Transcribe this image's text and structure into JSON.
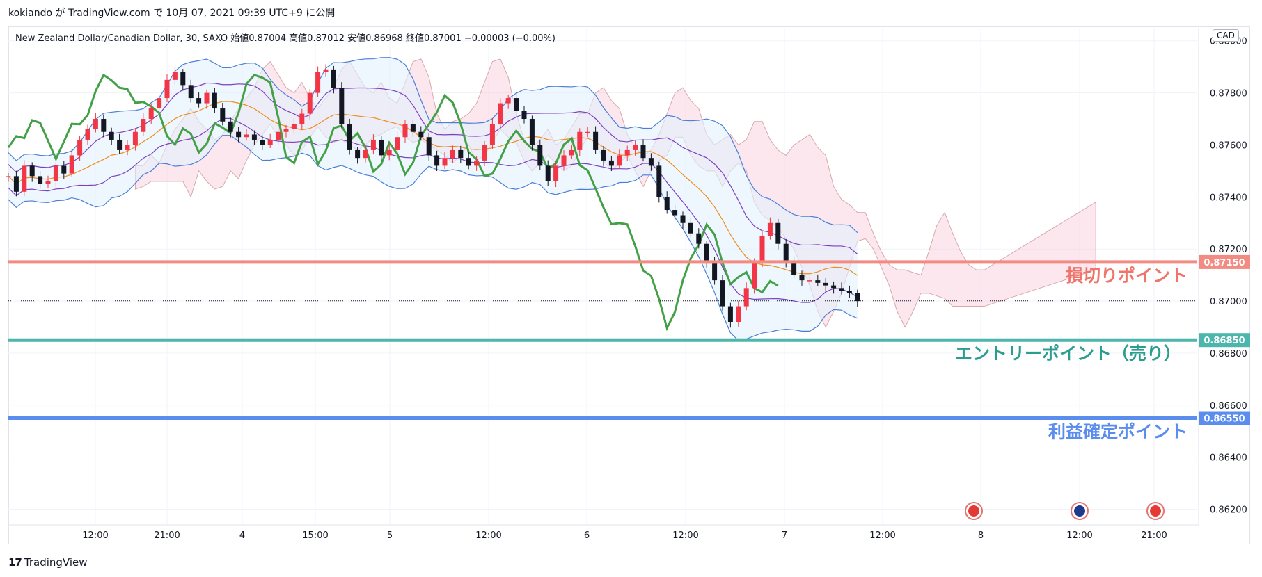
{
  "header": {
    "credit": "kokiando が TradingView.com で 10月 07, 2021 09:39 UTC+9 に公開",
    "legend": "New Zealand Dollar/Canadian Dollar, 30, SAXO  始値0.87004  高値0.87012  安値0.86968  終値0.87001  −0.00003 (−0.00%)",
    "currency": "CAD"
  },
  "footer": {
    "brand": "TradingView",
    "brand_mark": "17"
  },
  "chart_data": {
    "type": "candlestick",
    "symbol": "New Zealand Dollar/Canadian Dollar",
    "interval": "30",
    "source": "SAXO",
    "ohlc_last": {
      "open": 0.87004,
      "high": 0.87012,
      "low": 0.86968,
      "close": 0.87001
    },
    "change": "−0.00003 (−0.00%)",
    "y_axis": {
      "ticks": [
        "0.88000",
        "0.87800",
        "0.87600",
        "0.87400",
        "0.87200",
        "0.87000",
        "0.86800",
        "0.86600",
        "0.86400",
        "0.86200"
      ],
      "range": [
        0.8614,
        0.8805
      ]
    },
    "x_axis": {
      "ticks": [
        "12:00",
        "21:00",
        "4",
        "15:00",
        "5",
        "12:00",
        "6",
        "12:00",
        "7",
        "12:00",
        "8",
        "12:00",
        "21:00"
      ]
    },
    "levels": [
      {
        "price": 0.8715,
        "label_value": "0.87150",
        "annotation": "損切りポイント",
        "color": "#f28b82",
        "text_color": "#f07469"
      },
      {
        "price": 0.8685,
        "label_value": "0.86850",
        "annotation": "エントリーポイント（売り）",
        "color": "#4db6ac",
        "text_color": "#2a9d8f"
      },
      {
        "price": 0.8655,
        "label_value": "0.86550",
        "annotation": "利益確定ポイント",
        "color": "#5b8def",
        "text_color": "#5b8def"
      }
    ],
    "current_price": 0.87001,
    "close_path": [
      0.8748,
      0.8742,
      0.8752,
      0.8748,
      0.8745,
      0.8746,
      0.8752,
      0.8749,
      0.8756,
      0.8762,
      0.8766,
      0.877,
      0.8765,
      0.8762,
      0.8758,
      0.876,
      0.8765,
      0.877,
      0.8774,
      0.8778,
      0.8785,
      0.8788,
      0.8783,
      0.8778,
      0.8776,
      0.878,
      0.8774,
      0.8769,
      0.8765,
      0.8763,
      0.8764,
      0.8762,
      0.876,
      0.8762,
      0.8765,
      0.8766,
      0.8768,
      0.8772,
      0.878,
      0.8788,
      0.8789,
      0.8782,
      0.8768,
      0.8758,
      0.8755,
      0.8758,
      0.8762,
      0.8756,
      0.8758,
      0.8763,
      0.8768,
      0.8765,
      0.8763,
      0.8756,
      0.8752,
      0.8755,
      0.8758,
      0.8755,
      0.8752,
      0.8754,
      0.876,
      0.8768,
      0.8776,
      0.8778,
      0.8773,
      0.877,
      0.876,
      0.8752,
      0.8746,
      0.8752,
      0.8756,
      0.8758,
      0.8765,
      0.8765,
      0.8758,
      0.8754,
      0.8752,
      0.8756,
      0.8758,
      0.876,
      0.8755,
      0.8752,
      0.874,
      0.8735,
      0.8733,
      0.873,
      0.8726,
      0.8722,
      0.8715,
      0.8708,
      0.8698,
      0.8692,
      0.8698,
      0.8705,
      0.8715,
      0.8725,
      0.873,
      0.8722,
      0.8715,
      0.871,
      0.8708,
      0.8708,
      0.8707,
      0.8706,
      0.8705,
      0.8704,
      0.8703,
      0.87
    ],
    "candle_colors": {
      "up": "#f23645",
      "down": "#131722"
    },
    "indicators": [
      "Bollinger Bands",
      "Ichimoku Cloud",
      "Moving Average"
    ],
    "event_markers": [
      {
        "flag": "canada-flag-icon",
        "x_label": "8"
      },
      {
        "flag": "new-zealand-flag-icon",
        "x_label": "12:00"
      },
      {
        "flag": "canada-flag-icon",
        "x_label": "21:00"
      }
    ]
  }
}
